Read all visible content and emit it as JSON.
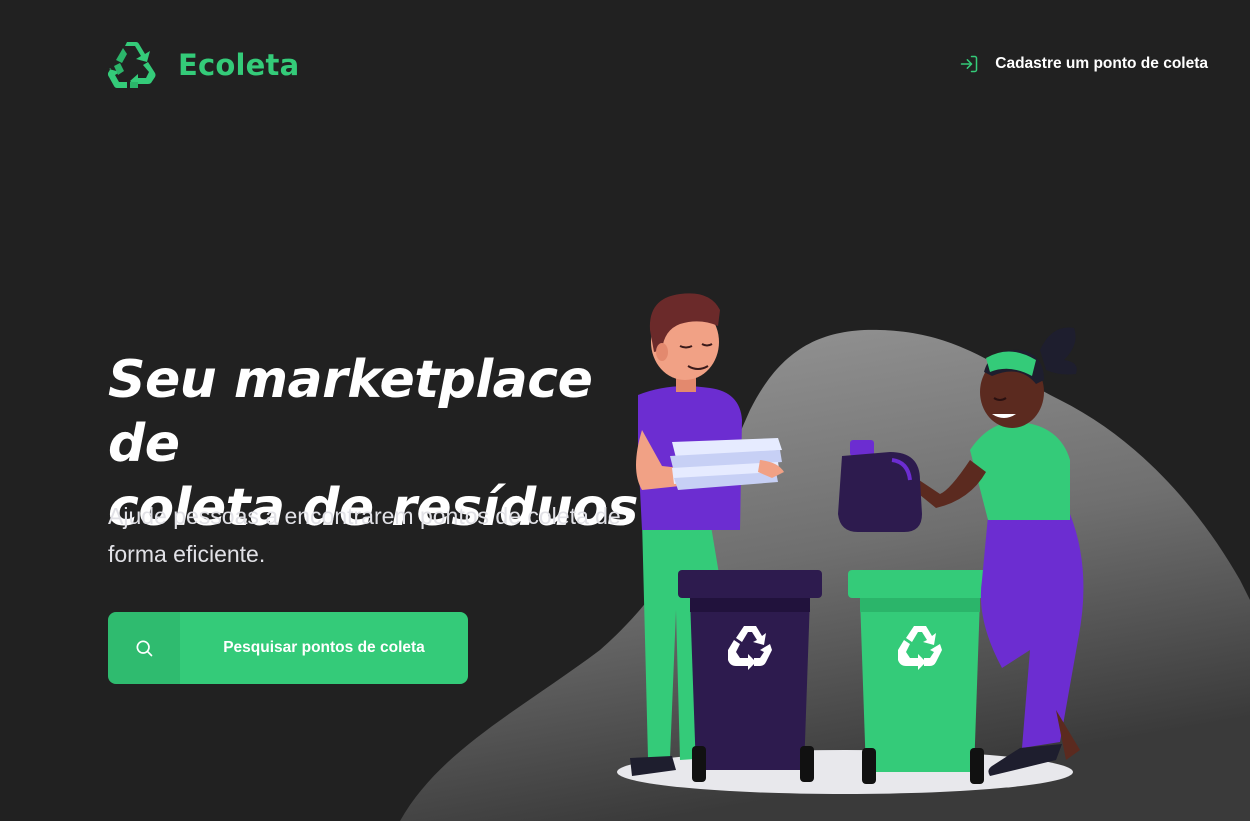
{
  "header": {
    "brand_name": "Ecoleta",
    "logo_icon": "recycle-icon",
    "register_link_label": "Cadastre um ponto de coleta",
    "register_link_icon": "log-in-icon"
  },
  "hero": {
    "title_line1": "Seu marketplace de",
    "title_line2": "coleta de resíduos",
    "subtitle": "Ajude pessoas a encontrarem pontos de coleta de forma eficiente."
  },
  "cta": {
    "label": "Pesquisar pontos de coleta",
    "icon": "search-icon"
  },
  "colors": {
    "background": "#212121",
    "brand_green": "#34cb79",
    "text": "#ffffff",
    "bin_dark": "#2d1b4e",
    "accent_purple": "#6c2dd1"
  }
}
